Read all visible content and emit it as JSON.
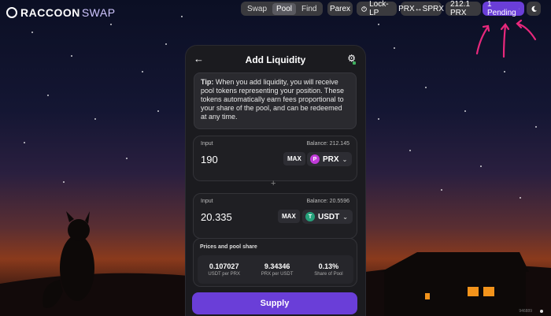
{
  "app": {
    "logo_main": "RACCOON",
    "logo_accent": "SWAP"
  },
  "nav": {
    "tabs": [
      {
        "label": "Swap"
      },
      {
        "label": "Pool",
        "active": true
      },
      {
        "label": "Find"
      }
    ]
  },
  "topbar": {
    "parex": "Parex",
    "lock_lp": "Lock-LP",
    "prx_sprx": "PRX↔SPRX",
    "balance": "212.1 PRX",
    "pending": "1 Pending"
  },
  "card": {
    "title": "Add Liquidity",
    "tip_bold": "Tip:",
    "tip_text": " When you add liquidity, you will receive pool tokens representing your position. These tokens automatically earn fees proportional to your share of the pool, and can be redeemed at any time.",
    "input1": {
      "label": "Input",
      "balance": "Balance: 212.145",
      "amount": "190",
      "max": "MAX",
      "token": "PRX",
      "token_color": "#c03ad8"
    },
    "plus": "+",
    "input2": {
      "label": "Input",
      "balance": "Balance: 20.5596",
      "amount": "20.335",
      "max": "MAX",
      "token": "USDT",
      "token_color": "#26a17b"
    },
    "prices": {
      "title": "Prices and pool share",
      "items": [
        {
          "value": "0.107027",
          "caption": "USDT per PRX"
        },
        {
          "value": "9.34346",
          "caption": "PRX per USDT"
        },
        {
          "value": "0.13%",
          "caption": "Share of Pool"
        }
      ]
    },
    "supply": "Supply"
  },
  "footer": {
    "block": "946889"
  },
  "colors": {
    "accent": "#6a3ed8",
    "annotation": "#e8287c"
  },
  "icons": [
    "back-arrow-icon",
    "gear-icon",
    "lock-icon",
    "spinner-icon",
    "moon-icon",
    "chevron-down-icon"
  ]
}
